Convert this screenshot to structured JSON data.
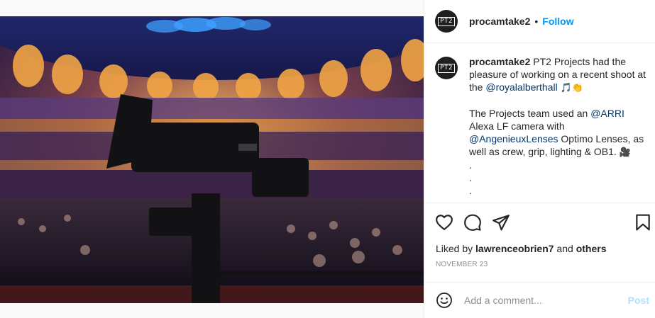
{
  "post": {
    "username": "procamtake2",
    "avatar_text": "PT2",
    "follow_label": "Follow",
    "separator": "•",
    "caption": {
      "username": "procamtake2",
      "line1_text": " PT2 Projects had the pleasure of working on a recent shoot at the ",
      "mention1": "@royalalberthall",
      "emoji1": "🎵👏",
      "line2_prefix": "The Projects team used an ",
      "mention2": "@ARRI",
      "line2_middle": " Alexa LF camera with ",
      "mention3": "@AngenieuxLenses",
      "line2_suffix": " Optimo Lenses, as well as crew, grip, lighting & OB1. ",
      "emoji2": "🎥",
      "dots": [
        ".",
        ".",
        "."
      ]
    },
    "liked_prefix": "Liked by ",
    "liked_user": "lawrenceobrien7",
    "liked_and": " and ",
    "liked_others": "others",
    "date": "NOVEMBER 23",
    "comment_placeholder": "Add a comment...",
    "post_label": "Post"
  },
  "photo": {
    "description_icon": "photo-image",
    "colors": {
      "ceiling": "#1b2a6b",
      "stage_light": "#f3b04f",
      "crowd": "#2a1c22"
    }
  },
  "colors": {
    "link": "#0095f6",
    "mention": "#00376b",
    "muted": "#8e8e8e",
    "post_disabled": "#b2dffc"
  }
}
